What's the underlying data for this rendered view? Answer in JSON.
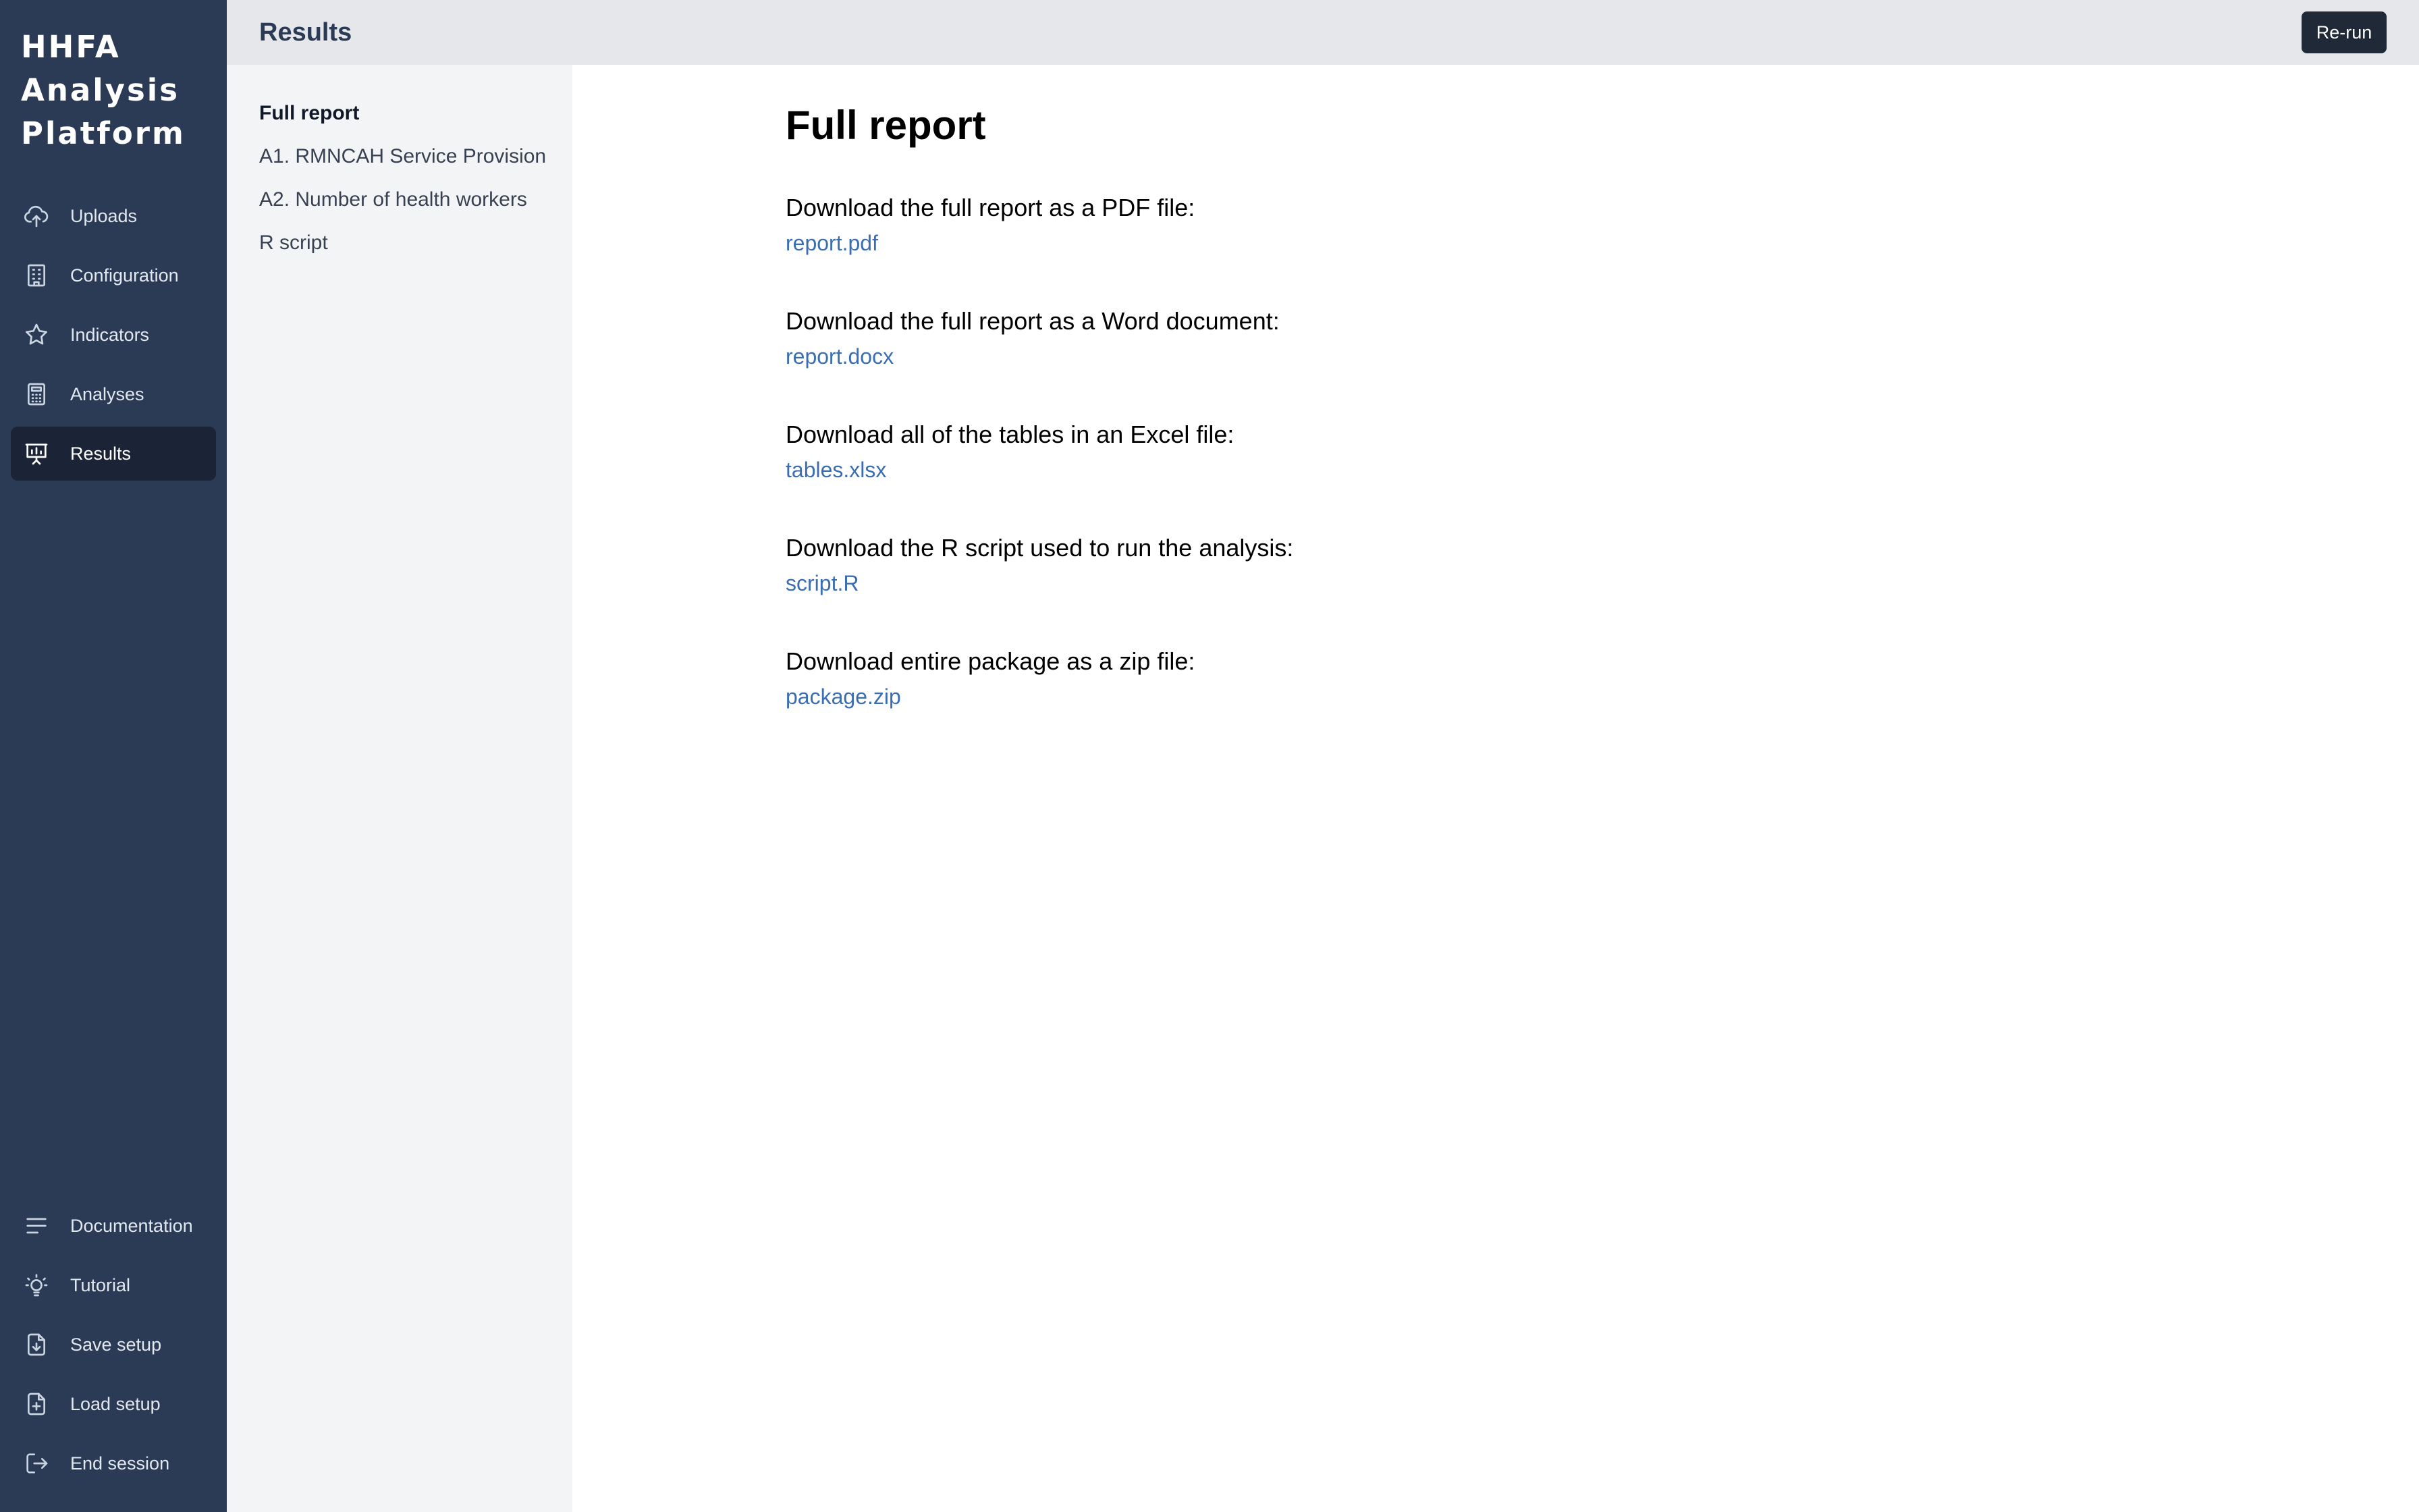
{
  "sidebar": {
    "brand_lines": [
      "HHFA",
      "Analysis",
      "Platform"
    ],
    "main_items": [
      {
        "label": "Uploads",
        "icon": "cloud-upload-icon"
      },
      {
        "label": "Configuration",
        "icon": "building-icon"
      },
      {
        "label": "Indicators",
        "icon": "star-icon"
      },
      {
        "label": "Analyses",
        "icon": "calculator-icon"
      },
      {
        "label": "Results",
        "icon": "presentation-chart-icon",
        "active": true
      }
    ],
    "bottom_items": [
      {
        "label": "Documentation",
        "icon": "lines-icon"
      },
      {
        "label": "Tutorial",
        "icon": "lightbulb-icon"
      },
      {
        "label": "Save setup",
        "icon": "file-download-icon"
      },
      {
        "label": "Load setup",
        "icon": "file-plus-icon"
      },
      {
        "label": "End session",
        "icon": "logout-icon"
      }
    ]
  },
  "header": {
    "title": "Results",
    "rerun_label": "Re-run"
  },
  "subnav": {
    "items": [
      {
        "label": "Full report",
        "active": true
      },
      {
        "label": "A1. RMNCAH Service Provision"
      },
      {
        "label": "A2. Number of health workers"
      },
      {
        "label": "R script"
      }
    ]
  },
  "main": {
    "heading": "Full report",
    "downloads": [
      {
        "label": "Download the full report as a PDF file:",
        "link": "report.pdf"
      },
      {
        "label": "Download the full report as a Word document:",
        "link": "report.docx"
      },
      {
        "label": "Download all of the tables in an Excel file:",
        "link": "tables.xlsx"
      },
      {
        "label": "Download the R script used to run the analysis:",
        "link": "script.R"
      },
      {
        "label": "Download entire package as a zip file:",
        "link": "package.zip"
      }
    ]
  },
  "colors": {
    "sidebar_bg": "#2b3a55",
    "sidebar_active_bg": "#1b2436",
    "header_bg": "#e5e7eb",
    "subnav_bg": "#f3f4f6",
    "link": "#3b6db3",
    "button_bg": "#1f2937"
  }
}
